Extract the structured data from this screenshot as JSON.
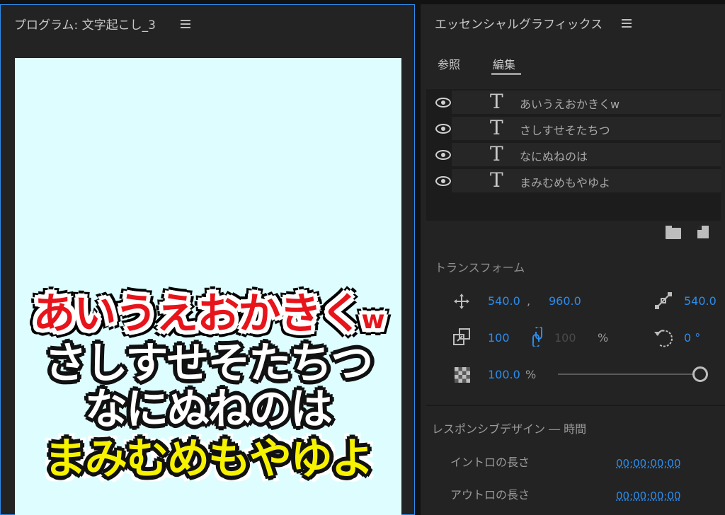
{
  "program_monitor": {
    "title": "プログラム: 文字起こし_3",
    "captions": [
      {
        "text": "あいうえおかきく",
        "suffix": "w",
        "color": "#e8141b"
      },
      {
        "text": "さしすせそたちつ",
        "color": "#ffffff"
      },
      {
        "text": "なにぬねのは",
        "color": "#ffffff"
      },
      {
        "text": "まみむめもやゆよ",
        "color": "#f7f200"
      }
    ],
    "background_color": "#defdfe"
  },
  "essential_graphics": {
    "title": "エッセンシャルグラフィックス",
    "tabs": [
      {
        "label": "参照"
      },
      {
        "label": "編集",
        "active": true
      }
    ],
    "layers": [
      {
        "label": "あいうえおかきくw",
        "icon": "eye-icon",
        "type_icon": "T"
      },
      {
        "label": "さしすせそたちつ",
        "icon": "eye-icon",
        "type_icon": "T"
      },
      {
        "label": "なにぬねのは",
        "icon": "eye-icon",
        "type_icon": "T"
      },
      {
        "label": "まみむめもやゆよ",
        "icon": "eye-icon",
        "type_icon": "T"
      }
    ],
    "transform": {
      "title": "トランスフォーム",
      "position_x": "540.0",
      "position_sep": ",",
      "position_y": "960.0",
      "anchor_x": "540.0",
      "scale": "100",
      "scale_width": "100",
      "scale_unit": "%",
      "rotation": "0 °",
      "opacity": "100.0",
      "opacity_unit": "%",
      "opacity_level": 1.0
    },
    "responsive": {
      "title": "レスポンシブデザイン ― 時間",
      "intro_label": "イントロの長さ",
      "intro_value": "00;00;00;00",
      "outro_label": "アウトロの長さ",
      "outro_value": "00;00;00;00"
    }
  }
}
